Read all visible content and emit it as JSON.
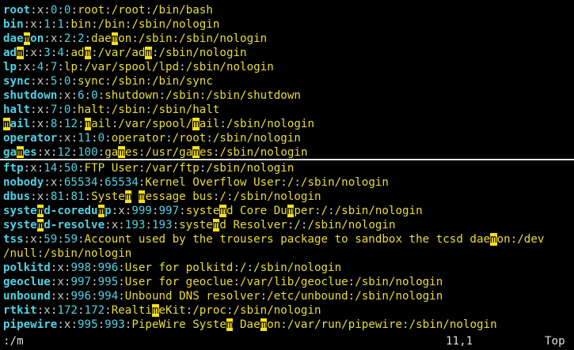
{
  "colors": {
    "username": "#4fd2e4",
    "ids": "#4fd2e4",
    "gecos": "#eadc3a",
    "match_bg": "#f7e11b",
    "background": "#000000"
  },
  "search_term": "m",
  "top_lines": [
    "root:x:0:0:root:/root:/bin/bash",
    "bin:x:1:1:bin:/bin:/sbin/nologin",
    "daemon:x:2:2:daemon:/sbin:/sbin/nologin",
    "adm:x:3:4:adm:/var/adm:/sbin/nologin",
    "lp:x:4:7:lp:/var/spool/lpd:/sbin/nologin",
    "sync:x:5:0:sync:/sbin:/bin/sync",
    "shutdown:x:6:0:shutdown:/sbin:/sbin/shutdown",
    "halt:x:7:0:halt:/sbin:/sbin/halt",
    "mail:x:8:12:mail:/var/spool/mail:/sbin/nologin",
    "operator:x:11:0:operator:/root:/sbin/nologin",
    "games:x:12:100:games:/usr/games:/sbin/nologin"
  ],
  "bottom_lines": [
    "ftp:x:14:50:FTP User:/var/ftp:/sbin/nologin",
    "nobody:x:65534:65534:Kernel Overflow User:/:/sbin/nologin",
    "dbus:x:81:81:System message bus:/:/sbin/nologin",
    "systemd-coredump:x:999:997:systemd Core Dumper:/:/sbin/nologin",
    "systemd-resolve:x:193:193:systemd Resolver:/:/sbin/nologin",
    "tss:x:59:59:Account used by the trousers package to sandbox the tcsd daemon:/dev",
    "/null:/sbin/nologin",
    "polkitd:x:998:996:User for polkitd:/:/sbin/nologin",
    "geoclue:x:997:995:User for geoclue:/var/lib/geoclue:/sbin/nologin",
    "unbound:x:996:994:Unbound DNS resolver:/etc/unbound:/sbin/nologin",
    "rtkit:x:172:172:RealtimeKit:/proc:/sbin/nologin",
    "pipewire:x:995:993:PipeWire System Daemon:/var/run/pipewire:/sbin/nologin"
  ],
  "status": {
    "command": ":/m",
    "cursor_position": "11,1",
    "scroll_position": "Top"
  }
}
